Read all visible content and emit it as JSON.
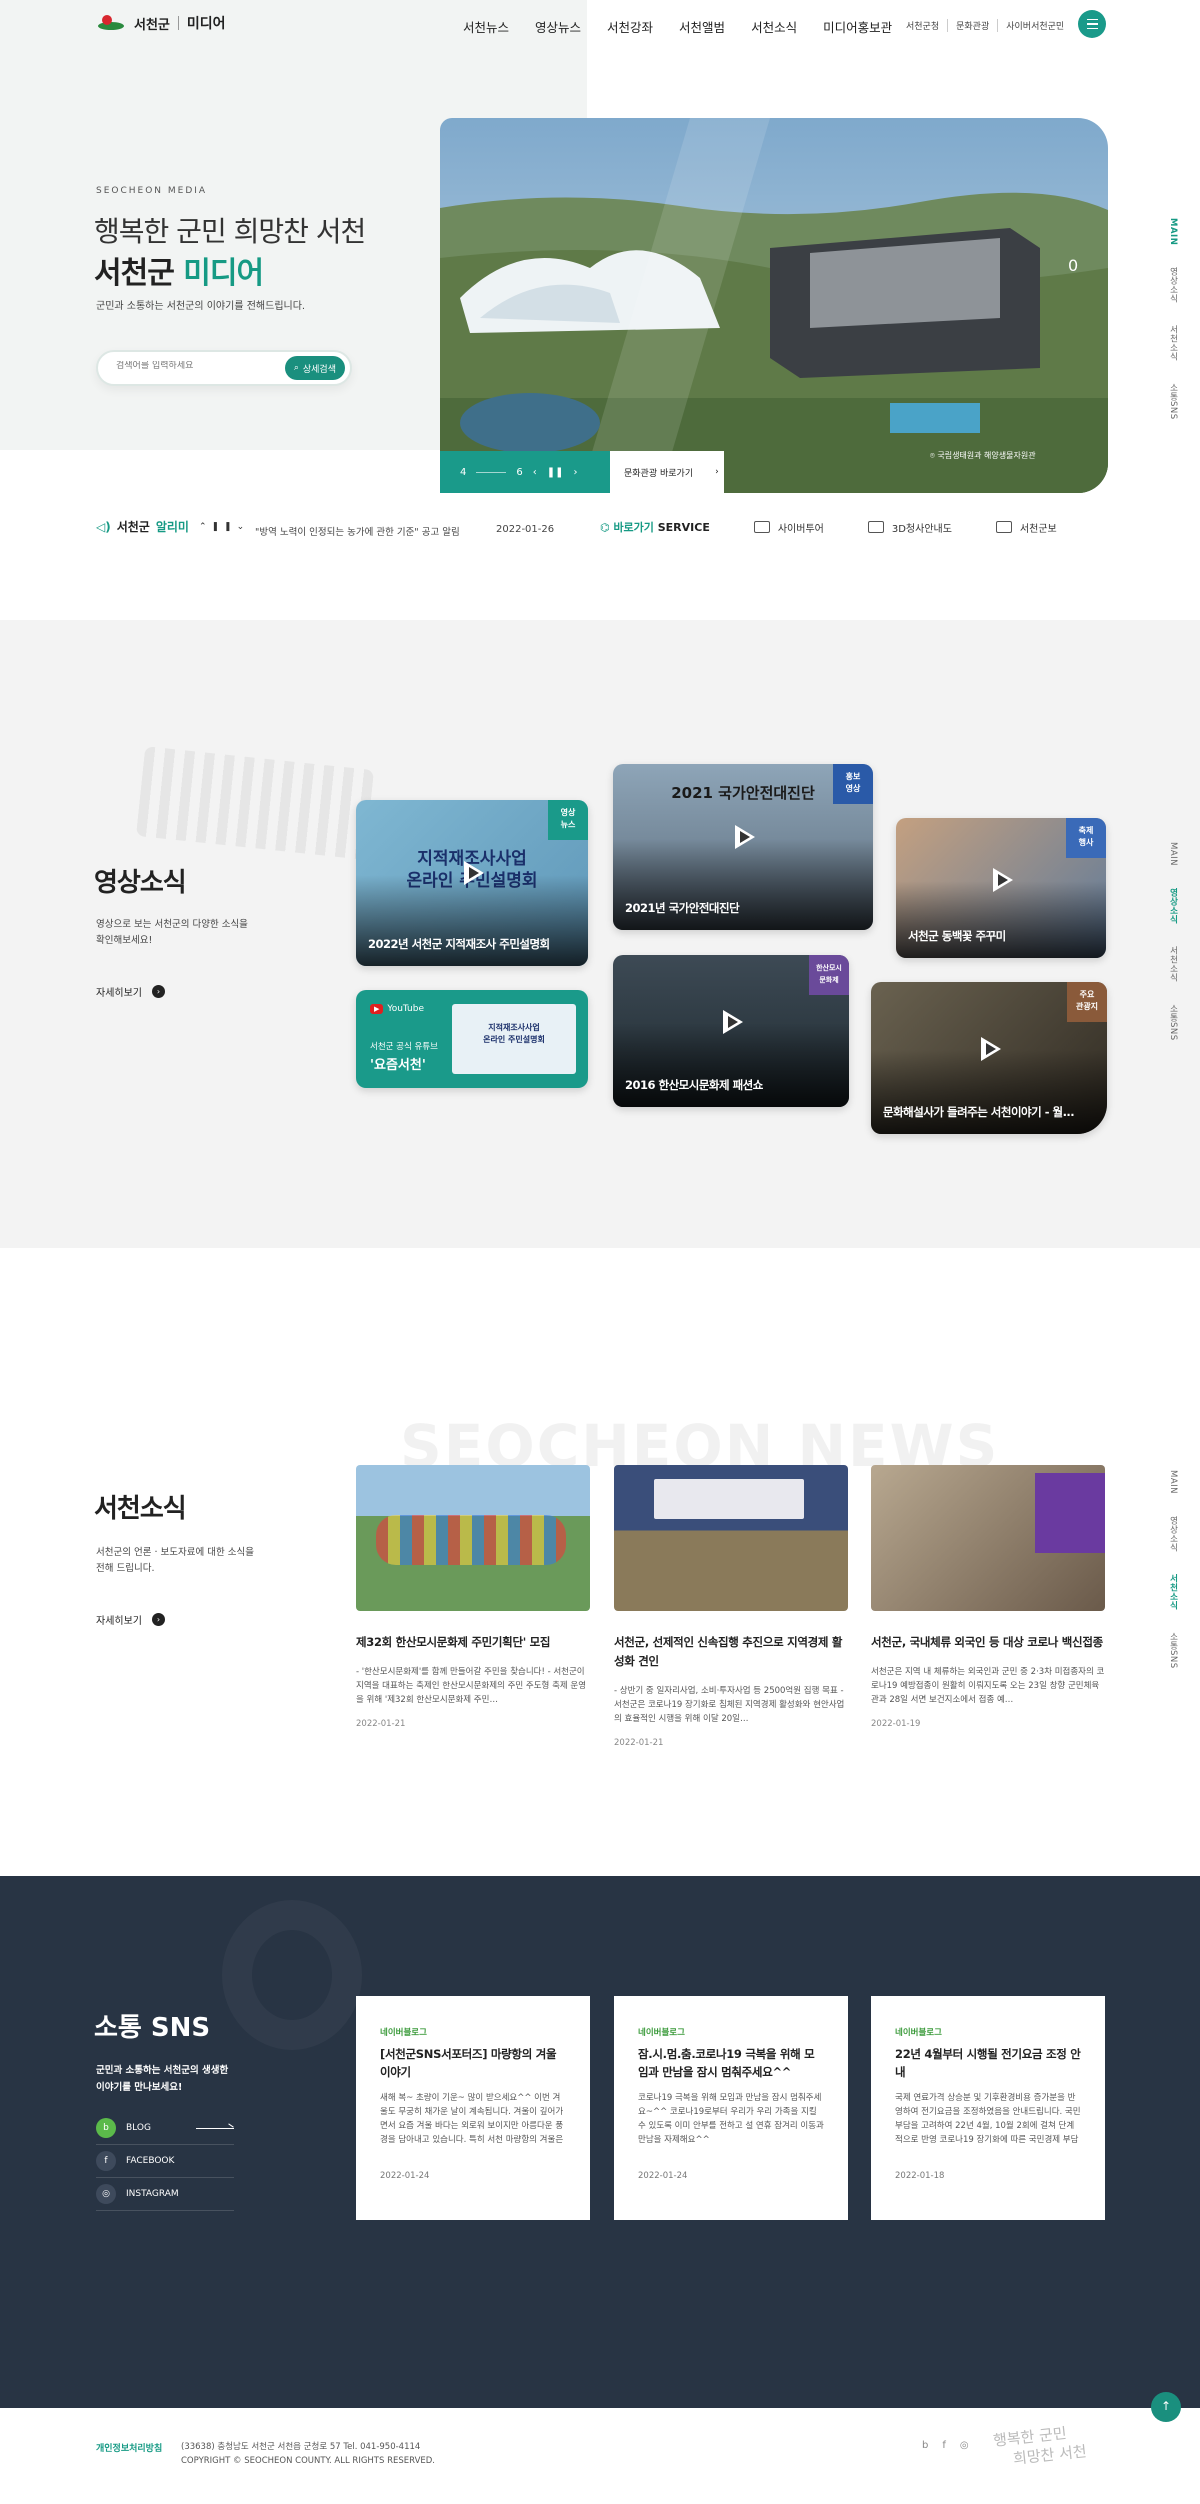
{
  "header": {
    "logo_text": "서천군",
    "logo_media": "미디어",
    "nav": [
      "서천뉴스",
      "영상뉴스",
      "서천강좌",
      "서천앨범",
      "서천소식",
      "미디어홍보관"
    ],
    "util": [
      "서천군청",
      "문화관광",
      "사이버서천군민"
    ],
    "menu_icon": "hamburger-icon",
    "accent_color": "#1a9a8a"
  },
  "hero": {
    "eyebrow": "SEOCHEON MEDIA",
    "line1": "행복한 군민 희망찬 서천",
    "line2_a": "서천군 ",
    "line2_b": "미디어",
    "desc": "군민과 소통하는 서천군의 이야기를 전해드립니다.",
    "search_placeholder": "검색어를 입력하세요",
    "search_button": "상세검색",
    "slide_current": "4",
    "slide_total": "6",
    "visit_button": "문화관광 바로가기",
    "photo_caption": "국립생태원과 해양생물자원관",
    "photo_counter": "0"
  },
  "side_nav": [
    "MAIN",
    "영상소식",
    "서천소식",
    "소통SNS"
  ],
  "notice": {
    "title_a": "서천군 ",
    "title_b": "알리미",
    "text": "\"방역 노력이 인정되는 농가에 관한 기준\" 공고 알림",
    "date": "2022-01-26"
  },
  "shortcuts": {
    "main_a": "바로가기 ",
    "main_b": "SERVICE",
    "items": [
      "사이버투어",
      "3D청사안내도",
      "서천군보"
    ]
  },
  "video": {
    "title": "영상소식",
    "desc1": "영상으로 보는 서천군의 다양한 소식을",
    "desc2": "확인해보세요!",
    "more": "자세히보기",
    "cards": [
      {
        "title": "2022년 서천군 지적재조사 주민설명회",
        "tag": "영상\n뉴스",
        "thumb_text": "지적재조사사업\n온라인 주민설명회",
        "tag_color": "#1a9a8a"
      },
      {
        "title": "2021년 국가안전대진단",
        "tag": "홍보\n영상",
        "thumb_text": "2021 국가안전대진단",
        "tag_color": "#2a5aa8"
      },
      {
        "title": "서천군 동백꽃 주꾸미",
        "tag": "축제\n행사",
        "thumb_text": "",
        "tag_color": "#3a6ab8"
      },
      {
        "title": "2016 한산모시문화제 패션쇼",
        "tag": "한산모시\n문화제",
        "thumb_text": "",
        "tag_color": "#6a4a9a"
      },
      {
        "title": "문화해설사가 들려주는 서천이야기 - 월...",
        "tag": "주요\n관광지",
        "thumb_text": "",
        "tag_color": "#8a5a3a"
      }
    ],
    "youtube": {
      "label": "YouTube",
      "line1": "서천군 공식 유튜브",
      "line2": "'요즘서천'",
      "inner": "지적재조사사업\n온라인 주민설명회"
    }
  },
  "news": {
    "bg_text": "SEOCHEON NEWS",
    "title": "서천소식",
    "desc1": "서천군의 언론 · 보도자료에 대한 소식을",
    "desc2": "전해 드립니다.",
    "more": "자세히보기",
    "cards": [
      {
        "title": "제32회 한산모시문화제 주민기획단' 모집",
        "body": "- '한산모시문화제'를 함께 만들어갈 주민을 찾습니다! - 서천군이 지역을 대표하는 축제인 한산모시문화제의 주민 주도형 축제 운영을 위해 '제32회 한산모시문화제 주민…",
        "date": "2022-01-21"
      },
      {
        "title": "서천군, 선제적인 신속집행 추진으로 지역경제 활성화 견인",
        "body": "- 상반기 중 일자리사업, 소비·투자사업 등 2500억원 집행 목표 - 서천군은 코로나19 장기화로 침체된 지역경제 활성화와 현안사업의 효율적인 시행을 위해 이달 20일…",
        "date": "2022-01-21"
      },
      {
        "title": "서천군, 국내체류 외국인 등 대상 코로나 백신접종",
        "body": "서천군은 지역 내 체류하는 외국인과 군민 중 2·3차 미접종자의 코로나19 예방접종이 원활히 이뤄지도록 오는 23일 창향 군민체육관과 28일 서면 보건지소에서 접종 예…",
        "date": "2022-01-19"
      }
    ]
  },
  "sns": {
    "title": "소통 SNS",
    "desc1": "군민과 소통하는 서천군의 생생한",
    "desc2": "이야기를 만나보세요!",
    "links": [
      {
        "label": "BLOG",
        "icon": "b"
      },
      {
        "label": "FACEBOOK",
        "icon": "f"
      },
      {
        "label": "INSTAGRAM",
        "icon": "◎"
      }
    ],
    "cards": [
      {
        "cat": "네이버블로그",
        "title": "[서천군SNS서포터즈] 마량항의 겨울이야기",
        "body": "새해 복~ 초량이 기운~ 많이 받으세요^^ 이번 겨울도 무궁히 채가운 날이 계속됩니다. 겨울이 깊어가면서 요즘 겨울 바다는 외로워 보이지만 아름다운 풍경을 담아내고 있습니다. 특히 서천 마량항의 겨울은 정박 중인 어선과 주변의 풍경과 어우러지면서 멋진 겨…",
        "date": "2022-01-24"
      },
      {
        "cat": "네이버블로그",
        "title": "잠.시.멈.춤.코로나19 극복을 위해 모임과 만남을 잠시 멈춰주세요^^",
        "body": "코로나19 극복을 위해 모임과 만남을 잠시 멈춰주세요~^^ 코로나19로부터 우리가 우리 가족을 지킬 수 있도록 이미 안부를 전하고 설 연휴 잠겨리 이동과 만남을 자제해요^^",
        "date": "2022-01-24"
      },
      {
        "cat": "네이버블로그",
        "title": "22년 4월부터 시행될 전기요금 조정 안내",
        "body": "국제 연료가격 상승분 및 기후환경비용 증가분을 반영하여 전기요금을 조정하였음을 안내드립니다. 국민 부담을 고려하여 22년 4월, 10월 2회에 걸쳐 단계적으로 반영 코로나19 장기화에 따른 국민경제 부담 고려 및 공객한 요금변화에 인한 소비자 부담 방지를 …",
        "date": "2022-01-18"
      }
    ]
  },
  "footer": {
    "privacy": "개인정보처리방침",
    "addr1": "(33638) 충청남도 서천군 서천읍 군청로 57   Tel. 041-950-4114",
    "addr2": "COPYRIGHT © SEOCHEON COUNTY. ALL RIGHTS RESERVED.",
    "icons": [
      "b",
      "f",
      "◎"
    ],
    "slogan1": "행복한 군민",
    "slogan2": "희망찬 서천"
  }
}
